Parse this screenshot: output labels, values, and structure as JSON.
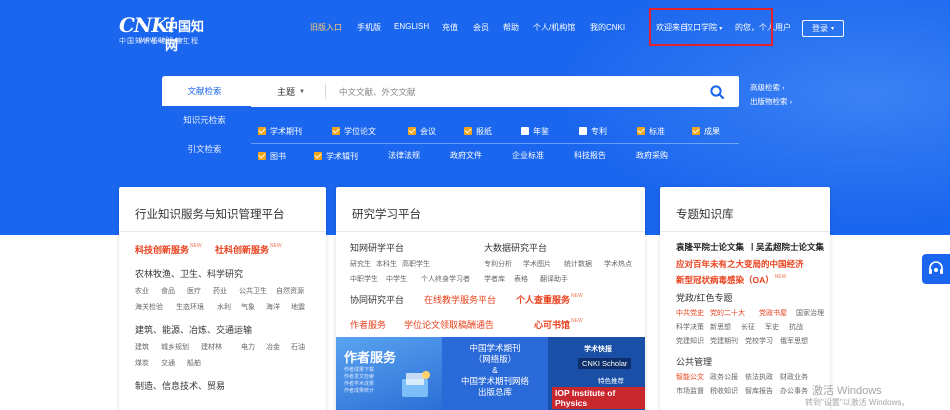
{
  "header": {
    "logo_text": "CNKi中国知网",
    "logo_url": "www.cnki.net",
    "logo_tagline": "中国知识基础设施工程",
    "nav": [
      "旧版入口",
      "手机版",
      "ENGLISH",
      "充值",
      "会员",
      "帮助",
      "个人/机构馆",
      "我的CNKI"
    ],
    "org_welcome": "欢迎来自",
    "org_name": "汉口学院",
    "user_greeting": "的您，个人用户",
    "login_label": "登录"
  },
  "side_tabs": [
    "文献检索",
    "知识元检索",
    "引文检索"
  ],
  "search": {
    "field": "主题",
    "placeholder": "中文文献、外文文献"
  },
  "advanced_links": [
    "高级检索",
    "出版物检索"
  ],
  "checkbox_row": [
    {
      "label": "学术期刊",
      "checked": true
    },
    {
      "label": "学位论文",
      "checked": true
    },
    {
      "label": "会议",
      "checked": true
    },
    {
      "label": "报纸",
      "checked": true
    },
    {
      "label": "年鉴",
      "checked": false
    },
    {
      "label": "专利",
      "checked": false
    },
    {
      "label": "标准",
      "checked": true
    },
    {
      "label": "成果",
      "checked": true
    }
  ],
  "second_row_checked": [
    {
      "label": "图书",
      "checked": true
    },
    {
      "label": "学术辑刊",
      "checked": true
    }
  ],
  "second_row_plain": [
    "法律法规",
    "政府文件",
    "企业标准",
    "科技报告",
    "政府采购"
  ],
  "card_left": {
    "title": "行业知识服务与知识管理平台",
    "highlight": [
      "科技创新服务",
      "社科创新服务"
    ],
    "new_tag": "NEW",
    "sections": [
      {
        "heading": "农林牧渔、卫生、科学研究",
        "rows": [
          [
            "农业",
            "食品",
            "医疗",
            "药业",
            "公共卫生",
            "自然资源"
          ],
          [
            "海关检验",
            "生态环境",
            "水利",
            "气象",
            "海洋",
            "地震"
          ]
        ]
      },
      {
        "heading": "建筑、能源、冶炼、交通运输",
        "rows": [
          [
            "建筑",
            "城乡规划",
            "建材林",
            "电力",
            "冶金",
            "石油"
          ],
          [
            "煤炭",
            "交通",
            "船舶"
          ]
        ]
      },
      {
        "heading": "制造、信息技术、贸易",
        "rows": []
      }
    ]
  },
  "card_mid": {
    "title": "研究学习平台",
    "col1_head": "知网研学平台",
    "col1_items": [
      [
        "研究生",
        "本科生",
        "高职学生"
      ],
      [
        "中职学生",
        "中学生",
        "个人终身学习者"
      ]
    ],
    "col2_head": "大数据研究平台",
    "col2_items": [
      [
        "专利分析",
        "学术图片",
        "统计数据",
        "学术热点"
      ],
      [
        "学者库",
        "表格",
        "翻译助手"
      ]
    ],
    "row3": [
      "协同研究平台",
      "在线教学服务平台",
      "个人查重服务"
    ],
    "row4": [
      "作者服务",
      "学位论文领取稿酬通告",
      "心可书馆"
    ],
    "banner": {
      "b1_title": "作者服务",
      "b1_lines": [
        "作者成果下载",
        "作者发文检索",
        "作者学术成果",
        "作者成果统计"
      ],
      "b2_lines": [
        "中国学术期刊",
        "（网络版）",
        "&",
        "中国学术期刊网络",
        "出版总库"
      ],
      "b3_t1": "CNKI Scholar",
      "b3_t0": "学术快报",
      "b3_t3": "特色推荐",
      "b3_t4": "IOP Institute of Physics"
    }
  },
  "card_right": {
    "title": "专题知识库",
    "bold_line": [
      "袁隆平院士论文集",
      "吴孟超院士论文集"
    ],
    "red1": "应对百年未有之大变局的中国经济",
    "red2": "新型冠状病毒感染（OA）",
    "section1": "党政/红色专题",
    "section1_rows": [
      [
        "中共党史",
        "党的二十大",
        "党政书屋",
        "国家治理"
      ],
      [
        "科学决策",
        "新思想",
        "长征",
        "军史",
        "抗战"
      ],
      [
        "党建知识",
        "党建期刊",
        "党校学习",
        "俄军思想"
      ]
    ],
    "section2": "公共管理",
    "section2_rows": [
      [
        "智能公文",
        "政务公报",
        "依法执政",
        "财政业务"
      ],
      [
        "市场监督",
        "税收知识",
        "智库报告",
        "办公事务"
      ]
    ]
  },
  "watermark": {
    "line1": "激活 Windows",
    "line2": "转到\"设置\"以激活 Windows。"
  },
  "colors": {
    "hero_blue": "#1a66ee",
    "accent_red": "#e8401c",
    "checked_orange": "#f2a516",
    "highlight_box": "#e8202a"
  }
}
